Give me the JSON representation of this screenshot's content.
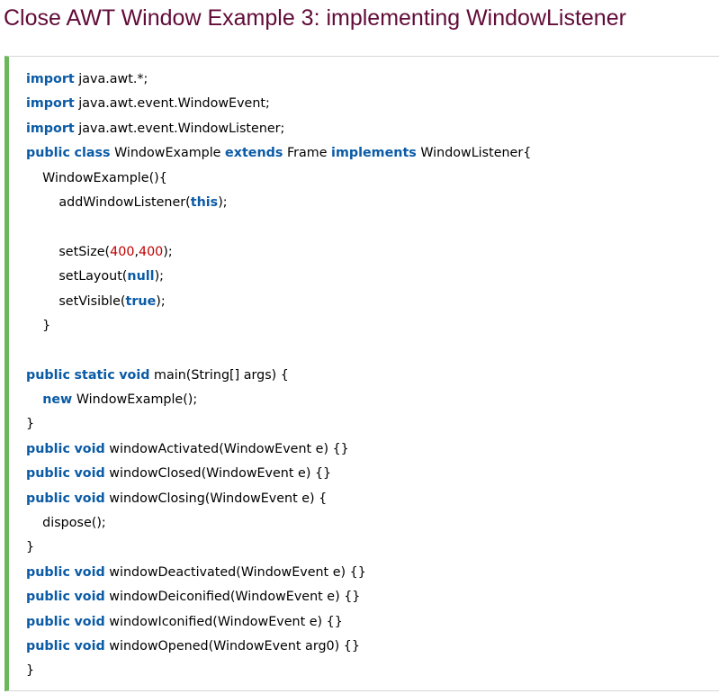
{
  "title": "Close AWT Window Example 3: implementing WindowListener",
  "colors": {
    "title": "#610b38",
    "keyword": "#0b5ba6",
    "number": "#c00000",
    "accent_bar": "#6bb85c"
  },
  "code": {
    "lines": [
      [
        {
          "t": "kw",
          "v": "import"
        },
        {
          "t": "plain",
          "v": " java.awt.*;"
        }
      ],
      [
        {
          "t": "kw",
          "v": "import"
        },
        {
          "t": "plain",
          "v": " java.awt.event.WindowEvent;"
        }
      ],
      [
        {
          "t": "kw",
          "v": "import"
        },
        {
          "t": "plain",
          "v": " java.awt.event.WindowListener;"
        }
      ],
      [
        {
          "t": "kw",
          "v": "public"
        },
        {
          "t": "plain",
          "v": " "
        },
        {
          "t": "kw",
          "v": "class"
        },
        {
          "t": "plain",
          "v": " WindowExample "
        },
        {
          "t": "kw",
          "v": "extends"
        },
        {
          "t": "plain",
          "v": " Frame "
        },
        {
          "t": "kw",
          "v": "implements"
        },
        {
          "t": "plain",
          "v": " WindowListener{"
        }
      ],
      [
        {
          "t": "plain",
          "v": "    WindowExample(){"
        }
      ],
      [
        {
          "t": "plain",
          "v": "        addWindowListener("
        },
        {
          "t": "kw",
          "v": "this"
        },
        {
          "t": "plain",
          "v": ");"
        }
      ],
      [],
      [
        {
          "t": "plain",
          "v": "        setSize("
        },
        {
          "t": "num",
          "v": "400"
        },
        {
          "t": "plain",
          "v": ","
        },
        {
          "t": "num",
          "v": "400"
        },
        {
          "t": "plain",
          "v": ");"
        }
      ],
      [
        {
          "t": "plain",
          "v": "        setLayout("
        },
        {
          "t": "kw",
          "v": "null"
        },
        {
          "t": "plain",
          "v": ");"
        }
      ],
      [
        {
          "t": "plain",
          "v": "        setVisible("
        },
        {
          "t": "kw",
          "v": "true"
        },
        {
          "t": "plain",
          "v": ");"
        }
      ],
      [
        {
          "t": "plain",
          "v": "    }"
        }
      ],
      [],
      [
        {
          "t": "kw",
          "v": "public"
        },
        {
          "t": "plain",
          "v": " "
        },
        {
          "t": "kw",
          "v": "static"
        },
        {
          "t": "plain",
          "v": " "
        },
        {
          "t": "kw",
          "v": "void"
        },
        {
          "t": "plain",
          "v": " main(String[] args) {"
        }
      ],
      [
        {
          "t": "plain",
          "v": "    "
        },
        {
          "t": "kw",
          "v": "new"
        },
        {
          "t": "plain",
          "v": " WindowExample();"
        }
      ],
      [
        {
          "t": "plain",
          "v": "}"
        }
      ],
      [
        {
          "t": "kw",
          "v": "public"
        },
        {
          "t": "plain",
          "v": " "
        },
        {
          "t": "kw",
          "v": "void"
        },
        {
          "t": "plain",
          "v": " windowActivated(WindowEvent e) {}"
        }
      ],
      [
        {
          "t": "kw",
          "v": "public"
        },
        {
          "t": "plain",
          "v": " "
        },
        {
          "t": "kw",
          "v": "void"
        },
        {
          "t": "plain",
          "v": " windowClosed(WindowEvent e) {}"
        }
      ],
      [
        {
          "t": "kw",
          "v": "public"
        },
        {
          "t": "plain",
          "v": " "
        },
        {
          "t": "kw",
          "v": "void"
        },
        {
          "t": "plain",
          "v": " windowClosing(WindowEvent e) {"
        }
      ],
      [
        {
          "t": "plain",
          "v": "    dispose();"
        }
      ],
      [
        {
          "t": "plain",
          "v": "}"
        }
      ],
      [
        {
          "t": "kw",
          "v": "public"
        },
        {
          "t": "plain",
          "v": " "
        },
        {
          "t": "kw",
          "v": "void"
        },
        {
          "t": "plain",
          "v": " windowDeactivated(WindowEvent e) {}"
        }
      ],
      [
        {
          "t": "kw",
          "v": "public"
        },
        {
          "t": "plain",
          "v": " "
        },
        {
          "t": "kw",
          "v": "void"
        },
        {
          "t": "plain",
          "v": " windowDeiconified(WindowEvent e) {}"
        }
      ],
      [
        {
          "t": "kw",
          "v": "public"
        },
        {
          "t": "plain",
          "v": " "
        },
        {
          "t": "kw",
          "v": "void"
        },
        {
          "t": "plain",
          "v": " windowIconified(WindowEvent e) {}"
        }
      ],
      [
        {
          "t": "kw",
          "v": "public"
        },
        {
          "t": "plain",
          "v": " "
        },
        {
          "t": "kw",
          "v": "void"
        },
        {
          "t": "plain",
          "v": " windowOpened(WindowEvent arg0) {}"
        }
      ],
      [
        {
          "t": "plain",
          "v": "}"
        }
      ]
    ]
  }
}
